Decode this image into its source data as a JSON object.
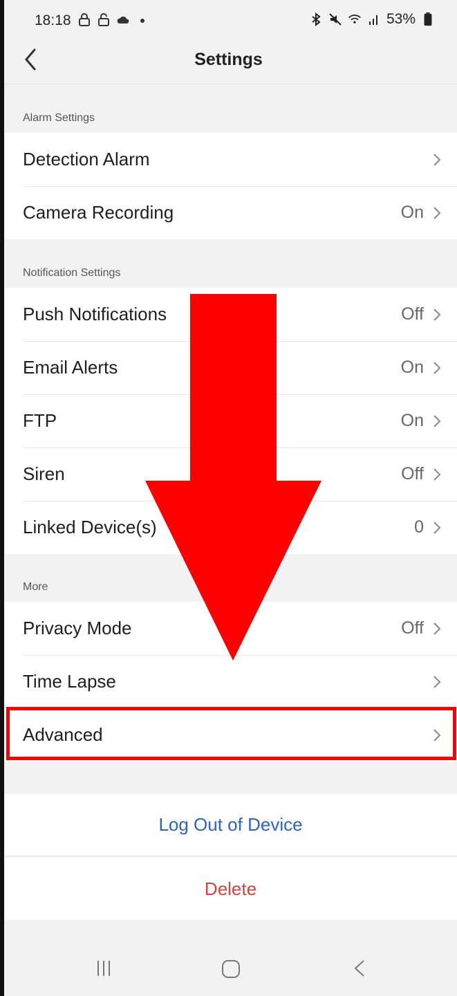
{
  "status_bar": {
    "time": "18:18",
    "battery": "53%",
    "icons_left": [
      "lock-icon",
      "lock-icon",
      "cloud-icon",
      "dot-icon"
    ],
    "icons_right": [
      "bluetooth-icon",
      "mute-icon",
      "wifi-icon",
      "signal-icon",
      "battery-icon"
    ]
  },
  "nav": {
    "title": "Settings"
  },
  "sections": {
    "alarm": {
      "header": "Alarm Settings",
      "rows": [
        {
          "label": "Detection Alarm",
          "value": ""
        },
        {
          "label": "Camera Recording",
          "value": "On"
        }
      ]
    },
    "notification": {
      "header": "Notification Settings",
      "rows": [
        {
          "label": "Push Notifications",
          "value": "Off"
        },
        {
          "label": "Email Alerts",
          "value": "On"
        },
        {
          "label": "FTP",
          "value": "On"
        },
        {
          "label": "Siren",
          "value": "Off"
        },
        {
          "label": "Linked Device(s)",
          "value": "0"
        }
      ]
    },
    "more": {
      "header": "More",
      "rows": [
        {
          "label": "Privacy Mode",
          "value": "Off"
        },
        {
          "label": "Time Lapse",
          "value": ""
        },
        {
          "label": "Advanced",
          "value": ""
        }
      ]
    }
  },
  "actions": {
    "logout": "Log Out of Device",
    "delete": "Delete"
  },
  "colors": {
    "accent_blue": "#2a64c8",
    "danger_red": "#d0453e",
    "annotation_red": "#ff0000"
  }
}
